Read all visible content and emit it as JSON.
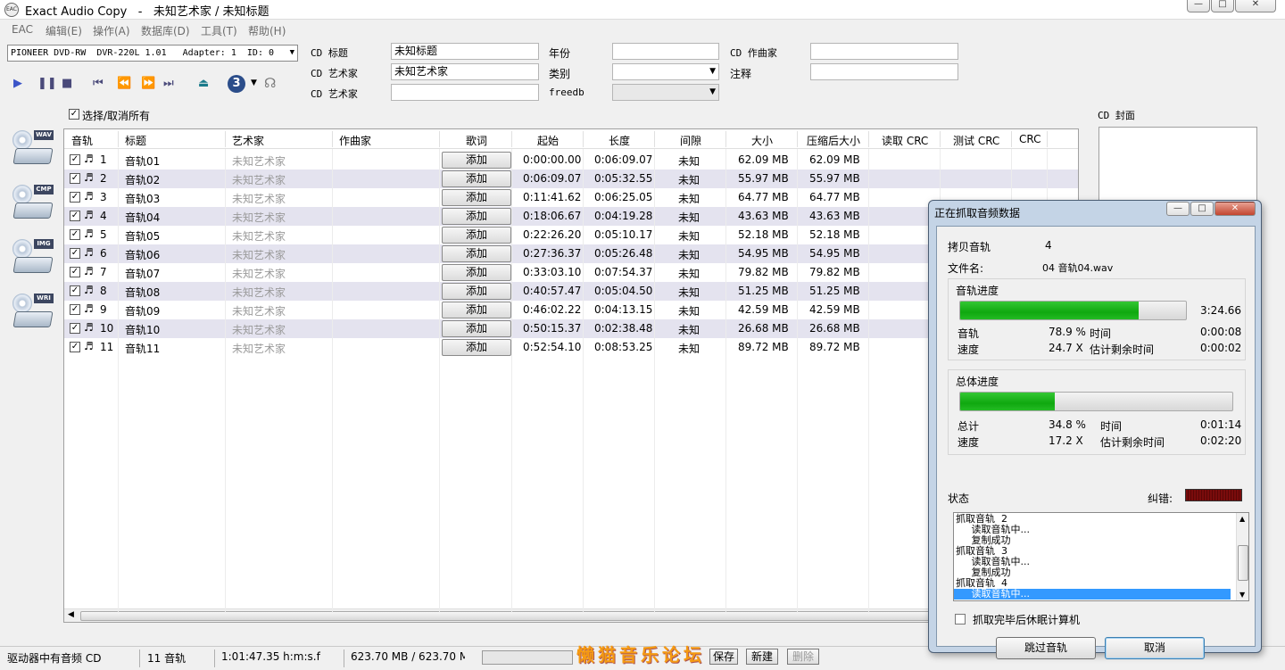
{
  "window": {
    "app_name": "Exact Audio Copy",
    "separator": "-",
    "doc_title": "未知艺术家 / 未知标题",
    "min": "—",
    "max": "□",
    "close": "✕"
  },
  "menu": [
    "EAC",
    "编辑(E)",
    "操作(A)",
    "数据库(D)",
    "工具(T)",
    "帮助(H)"
  ],
  "drive": {
    "label": "PIONEER DVD-RW  DVR-220L 1.01   Adapter: 1  ID: 0"
  },
  "cd_info": {
    "title_label": "CD 标题",
    "title_value": "未知标题",
    "artist_label": "CD 艺术家",
    "artist_value": "未知艺术家",
    "artist2_label": "CD 艺术家",
    "artist2_value": "",
    "year_label": "年份",
    "year_value": "",
    "genre_label": "类别",
    "genre_value": "",
    "freedb_label": "freedb",
    "freedb_value": "",
    "composer_label": "CD 作曲家",
    "composer_value": "",
    "comment_label": "注释",
    "comment_value": ""
  },
  "select_all": "选择/取消所有",
  "cover_label": "CD 封面",
  "speed": "3",
  "side_icons": [
    "WAV",
    "CMP",
    "IMG",
    "WRI"
  ],
  "columns": [
    "音轨",
    "标题",
    "艺术家",
    "作曲家",
    "歌词",
    "起始",
    "长度",
    "间隙",
    "大小",
    "压缩后大小",
    "读取 CRC",
    "测试 CRC",
    "CRC"
  ],
  "tracks": [
    {
      "no": "1",
      "title": "音轨01",
      "artist": "未知艺术家",
      "lyrics": "添加",
      "start": "0:00:00.00",
      "length": "0:06:09.07",
      "gap": "未知",
      "size": "62.09 MB",
      "csize": "62.09 MB"
    },
    {
      "no": "2",
      "title": "音轨02",
      "artist": "未知艺术家",
      "lyrics": "添加",
      "start": "0:06:09.07",
      "length": "0:05:32.55",
      "gap": "未知",
      "size": "55.97 MB",
      "csize": "55.97 MB"
    },
    {
      "no": "3",
      "title": "音轨03",
      "artist": "未知艺术家",
      "lyrics": "添加",
      "start": "0:11:41.62",
      "length": "0:06:25.05",
      "gap": "未知",
      "size": "64.77 MB",
      "csize": "64.77 MB"
    },
    {
      "no": "4",
      "title": "音轨04",
      "artist": "未知艺术家",
      "lyrics": "添加",
      "start": "0:18:06.67",
      "length": "0:04:19.28",
      "gap": "未知",
      "size": "43.63 MB",
      "csize": "43.63 MB"
    },
    {
      "no": "5",
      "title": "音轨05",
      "artist": "未知艺术家",
      "lyrics": "添加",
      "start": "0:22:26.20",
      "length": "0:05:10.17",
      "gap": "未知",
      "size": "52.18 MB",
      "csize": "52.18 MB"
    },
    {
      "no": "6",
      "title": "音轨06",
      "artist": "未知艺术家",
      "lyrics": "添加",
      "start": "0:27:36.37",
      "length": "0:05:26.48",
      "gap": "未知",
      "size": "54.95 MB",
      "csize": "54.95 MB"
    },
    {
      "no": "7",
      "title": "音轨07",
      "artist": "未知艺术家",
      "lyrics": "添加",
      "start": "0:33:03.10",
      "length": "0:07:54.37",
      "gap": "未知",
      "size": "79.82 MB",
      "csize": "79.82 MB"
    },
    {
      "no": "8",
      "title": "音轨08",
      "artist": "未知艺术家",
      "lyrics": "添加",
      "start": "0:40:57.47",
      "length": "0:05:04.50",
      "gap": "未知",
      "size": "51.25 MB",
      "csize": "51.25 MB"
    },
    {
      "no": "9",
      "title": "音轨09",
      "artist": "未知艺术家",
      "lyrics": "添加",
      "start": "0:46:02.22",
      "length": "0:04:13.15",
      "gap": "未知",
      "size": "42.59 MB",
      "csize": "42.59 MB"
    },
    {
      "no": "10",
      "title": "音轨10",
      "artist": "未知艺术家",
      "lyrics": "添加",
      "start": "0:50:15.37",
      "length": "0:02:38.48",
      "gap": "未知",
      "size": "26.68 MB",
      "csize": "26.68 MB"
    },
    {
      "no": "11",
      "title": "音轨11",
      "artist": "未知艺术家",
      "lyrics": "添加",
      "start": "0:52:54.10",
      "length": "0:08:53.25",
      "gap": "未知",
      "size": "89.72 MB",
      "csize": "89.72 MB"
    }
  ],
  "statusbar": {
    "media": "驱动器中有音频 CD",
    "tracks": "11 音轨",
    "duration": "1:01:47.35 h:m:s.f",
    "size": "623.70 MB / 623.70 M",
    "save": "保存",
    "new": "新建",
    "delete": "删除"
  },
  "dialog": {
    "title": "正在抓取音频数据",
    "copy_track_label": "拷贝音轨",
    "copy_track_value": "4",
    "filename_label": "文件名:",
    "filename_value": "04 音轨04.wav",
    "track_group": "音轨进度",
    "track_time": "3:24.66",
    "track_progress": 0.789,
    "track_label": "音轨",
    "track_pct": "78.9 %",
    "time_label": "时间",
    "track_elapsed": "0:00:08",
    "speed_label": "速度",
    "track_speed": "24.7 X",
    "remaining_label": "估计剩余时间",
    "track_remaining": "0:00:02",
    "total_group": "总体进度",
    "total_progress": 0.348,
    "total_label": "总计",
    "total_pct": "34.8 %",
    "total_elapsed": "0:01:14",
    "total_speed": "17.2 X",
    "total_remaining": "0:02:20",
    "status_label": "状态",
    "error_label": "纠错:",
    "log": [
      "抓取音轨  2",
      "     读取音轨中...",
      "     复制成功",
      "抓取音轨  3",
      "     读取音轨中...",
      "     复制成功",
      "抓取音轨  4",
      "     读取音轨中..."
    ],
    "shutdown_label": "抓取完毕后休眠计算机",
    "skip_button": "跳过音轨",
    "cancel_button": "取消"
  },
  "watermark": "懒猫音乐论坛"
}
